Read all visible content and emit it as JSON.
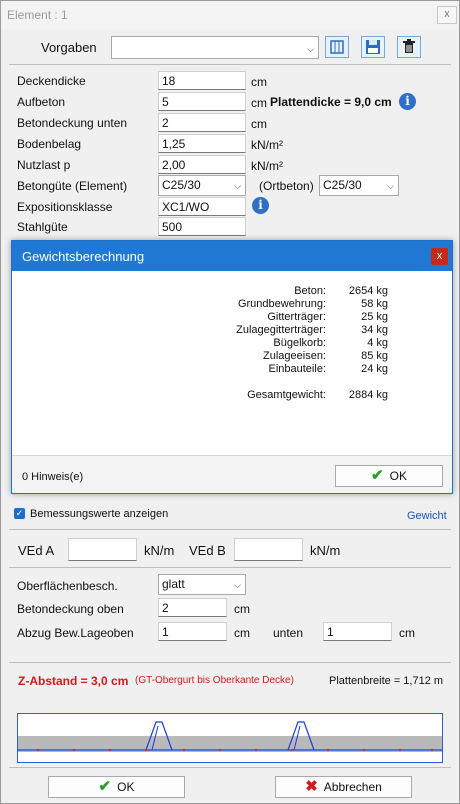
{
  "window": {
    "title": "Element : 1",
    "close_glyph": "x"
  },
  "vorgaben": {
    "label": "Vorgaben",
    "value": ""
  },
  "fields": [
    {
      "label": "Deckendicke",
      "value": "18",
      "unit": "cm"
    },
    {
      "label": "Aufbeton",
      "value": "5",
      "unit": "cm"
    },
    {
      "label": "Betondeckung unten",
      "value": "2",
      "unit": "cm"
    },
    {
      "label": "Bodenbelag",
      "value": "1,25",
      "unit": "kN/m²"
    },
    {
      "label": "Nutzlast p",
      "value": "2,00",
      "unit": "kN/m²"
    },
    {
      "label": "Betongüte (Element)",
      "value": "C25/30"
    },
    {
      "label": "Expositionsklasse",
      "value": "XC1/WO"
    },
    {
      "label": "Stahlgüte",
      "value": "500"
    }
  ],
  "plattendicke": "Plattendicke = 9,0 cm",
  "ortbeton": {
    "label": "(Ortbeton)",
    "value": "C25/30"
  },
  "dialog": {
    "title": "Gewichtsberechnung",
    "close_glyph": "x",
    "rows": [
      {
        "label": "Beton:",
        "value": "2654 kg"
      },
      {
        "label": "Grundbewehrung:",
        "value": "58 kg"
      },
      {
        "label": "Gitterträger:",
        "value": "25 kg"
      },
      {
        "label": "Zulagegitterträger:",
        "value": "34 kg"
      },
      {
        "label": "Bügelkorb:",
        "value": "4 kg"
      },
      {
        "label": "Zulageeisen:",
        "value": "85 kg"
      },
      {
        "label": "Einbauteile:",
        "value": "24 kg"
      }
    ],
    "total_label": "Gesamtgewicht:",
    "total_value": "2884 kg",
    "hint": "0 Hinweis(e)",
    "ok_label": "OK"
  },
  "bemessung": {
    "label": "Bemessungswerte anzeigen",
    "checked": true,
    "link": "Gewicht"
  },
  "ved": {
    "a_label": "VEd A",
    "a_value": "",
    "a_unit": "kN/m",
    "b_label": "VEd B",
    "b_value": "",
    "b_unit": "kN/m"
  },
  "oberflaeche": {
    "label": "Oberflächenbesch.",
    "value": "glatt"
  },
  "betondeckung_oben": {
    "label": "Betondeckung oben",
    "value": "2",
    "unit": "cm"
  },
  "abzug": {
    "label": "Abzug Bew.Lage",
    "oben_label": "oben",
    "oben_value": "1",
    "oben_unit": "cm",
    "unten_label": "unten",
    "unten_value": "1",
    "unten_unit": "cm"
  },
  "z_abstand": {
    "text": "Z-Abstand = 3,0 cm",
    "note": "(GT-Obergurt bis Oberkante Decke)",
    "plattenbreite": "Plattenbreite = 1,712 m"
  },
  "footer": {
    "ok_label": "OK",
    "cancel_label": "Abbrechen"
  },
  "colors": {
    "accent": "#1f79d4",
    "red": "#d21a1a",
    "green": "#2a9a2a"
  }
}
